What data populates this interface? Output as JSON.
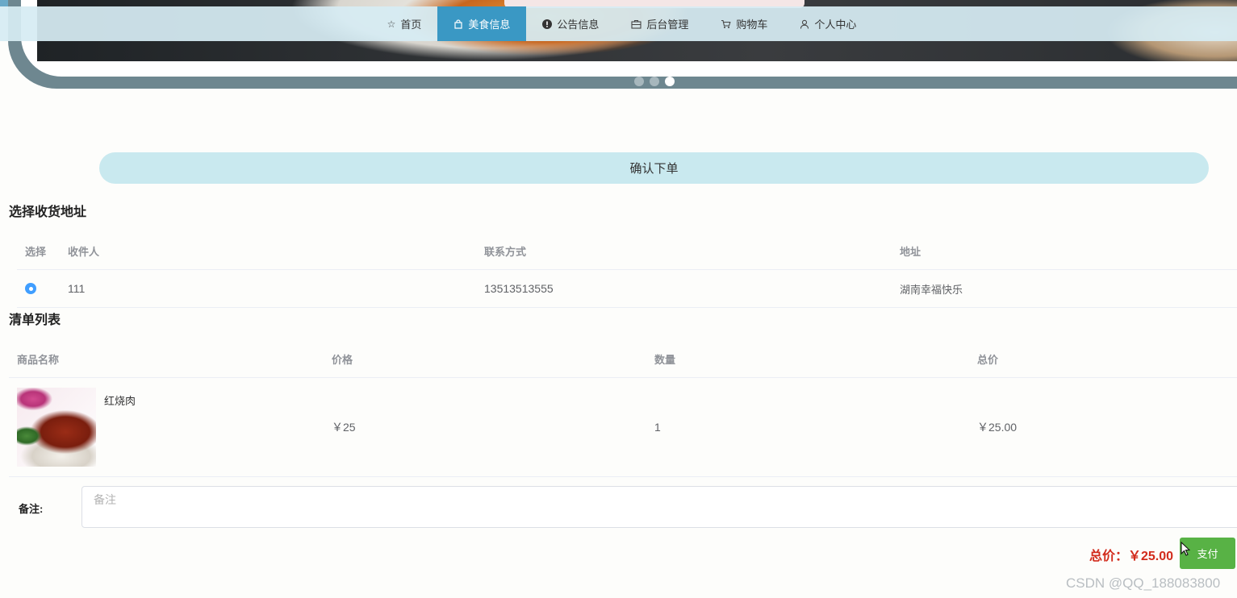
{
  "nav": {
    "items": [
      {
        "label": "首页",
        "icon": "star-icon",
        "glyph": "☆",
        "active": false
      },
      {
        "label": "美食信息",
        "icon": "bag-icon",
        "glyph": "🛍",
        "active": true
      },
      {
        "label": "公告信息",
        "icon": "alert-icon",
        "glyph": "❗",
        "active": false
      },
      {
        "label": "后台管理",
        "icon": "briefcase-icon",
        "glyph": "▣",
        "active": false
      },
      {
        "label": "购物车",
        "icon": "cart-icon",
        "glyph": "🛒",
        "active": false
      },
      {
        "label": "个人中心",
        "icon": "user-icon",
        "glyph": "♙",
        "active": false
      }
    ],
    "active_color": "#3a98c4"
  },
  "carousel": {
    "slide_count": 3,
    "active_index": 2
  },
  "confirm": {
    "title": "确认下单"
  },
  "address": {
    "title": "选择收货地址",
    "headers": {
      "select": "选择",
      "name": "收件人",
      "phone": "联系方式",
      "address": "地址"
    },
    "rows": [
      {
        "selected": true,
        "name": "111",
        "phone": "13513513555",
        "address": "湖南幸福快乐"
      }
    ]
  },
  "list": {
    "title": "清单列表",
    "headers": {
      "name": "商品名称",
      "price": "价格",
      "qty": "数量",
      "total": "总价"
    },
    "rows": [
      {
        "name": "红烧肉",
        "price": "￥25",
        "qty": "1",
        "total": "￥25.00"
      }
    ]
  },
  "remark": {
    "label": "备注:",
    "placeholder": "备注",
    "value": ""
  },
  "summary": {
    "total_text": "总价：￥25.00",
    "pay_label": "支付",
    "pay_color": "#58b245",
    "total_color": "#d22b1c"
  },
  "watermark": "CSDN @QQ_188083800"
}
